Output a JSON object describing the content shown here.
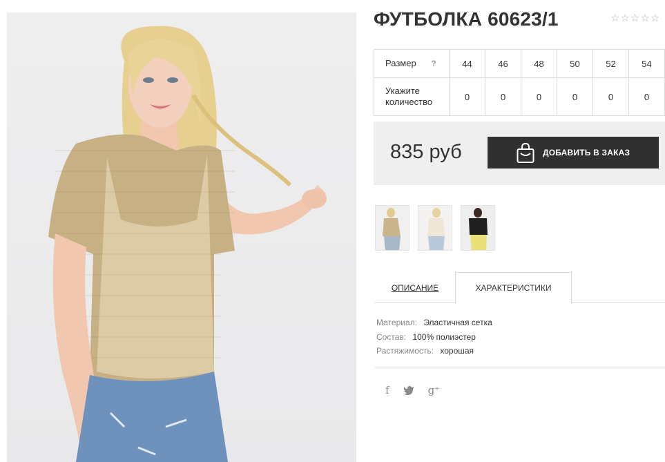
{
  "product": {
    "title": "ФУТБОЛКА 60623/1",
    "rating_stars": "☆☆☆☆☆",
    "image_alt": "model wearing beige mesh t-shirt over camisole with blue ripped jeans"
  },
  "sizes": {
    "size_label": "Размер",
    "size_help": "?",
    "qty_label_line1": "Укажите",
    "qty_label_line2": "количество",
    "items": [
      {
        "size": "44",
        "qty": "0"
      },
      {
        "size": "46",
        "qty": "0"
      },
      {
        "size": "48",
        "qty": "0"
      },
      {
        "size": "50",
        "qty": "0"
      },
      {
        "size": "52",
        "qty": "0"
      },
      {
        "size": "54",
        "qty": "0"
      }
    ]
  },
  "buy": {
    "price": "835 руб",
    "add_label": "ДОБАВИТЬ В ЗАКАЗ",
    "icon": "shopping-bag-icon"
  },
  "thumbnails": [
    {
      "name": "thumbnail-beige",
      "colors": [
        "#c9b48c",
        "#d9c5a0",
        "#a9b8c9"
      ]
    },
    {
      "name": "thumbnail-white",
      "colors": [
        "#efe6d8",
        "#f3ece3",
        "#b9c9db"
      ]
    },
    {
      "name": "thumbnail-black",
      "colors": [
        "#1f1f1f",
        "#333333",
        "#e9e07a"
      ]
    }
  ],
  "tabs": {
    "description": "ОПИСАНИЕ",
    "characteristics": "ХАРАКТЕРИСТИКИ"
  },
  "specs": [
    {
      "key": "Материал:",
      "value": "Эластичная сетка"
    },
    {
      "key": "Состав:",
      "value": "100% полиэстер"
    },
    {
      "key": "Растяжимость:",
      "value": "хорошая"
    }
  ],
  "social": {
    "facebook": "f",
    "twitter": "🐦",
    "googleplus": "g⁺"
  },
  "colors": {
    "button_bg": "#303030",
    "buybox_bg": "#efefef",
    "border": "#dcdcdc"
  }
}
